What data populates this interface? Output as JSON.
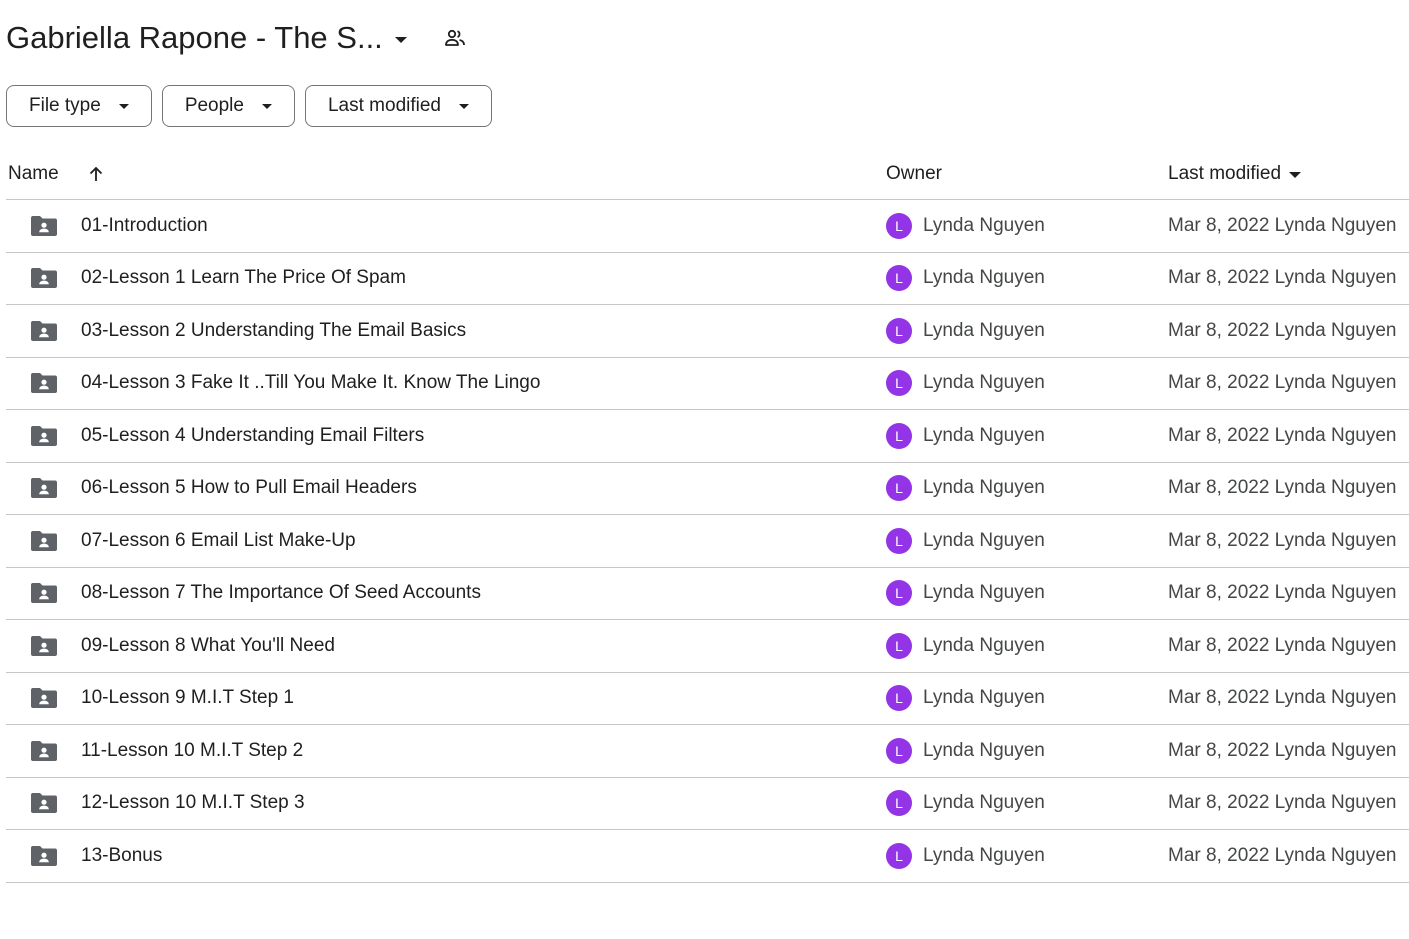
{
  "header": {
    "title": "Gabriella Rapone - The S...",
    "caret_icon": "arrow-drop-down-icon",
    "shared_icon": "people-icon"
  },
  "filters": [
    {
      "label": "File type"
    },
    {
      "label": "People"
    },
    {
      "label": "Last modified"
    }
  ],
  "columns": {
    "name": "Name",
    "owner": "Owner",
    "last_modified": "Last modified"
  },
  "colors": {
    "avatar": "#9334e6",
    "folder": "#5f6368",
    "divider": "#c7c7c7"
  },
  "rows": [
    {
      "name": "01-Introduction",
      "owner_initial": "L",
      "owner": "Lynda Nguyen",
      "modified": "Mar 8, 2022 Lynda Nguyen"
    },
    {
      "name": "02-Lesson 1  Learn The Price Of Spam",
      "owner_initial": "L",
      "owner": "Lynda Nguyen",
      "modified": "Mar 8, 2022 Lynda Nguyen"
    },
    {
      "name": "03-Lesson 2 Understanding The Email Basics",
      "owner_initial": "L",
      "owner": "Lynda Nguyen",
      "modified": "Mar 8, 2022 Lynda Nguyen"
    },
    {
      "name": "04-Lesson 3 Fake It ..Till You Make It. Know The Lingo",
      "owner_initial": "L",
      "owner": "Lynda Nguyen",
      "modified": "Mar 8, 2022 Lynda Nguyen"
    },
    {
      "name": "05-Lesson 4 Understanding Email Filters",
      "owner_initial": "L",
      "owner": "Lynda Nguyen",
      "modified": "Mar 8, 2022 Lynda Nguyen"
    },
    {
      "name": "06-Lesson 5 How to Pull Email Headers",
      "owner_initial": "L",
      "owner": "Lynda Nguyen",
      "modified": "Mar 8, 2022 Lynda Nguyen"
    },
    {
      "name": "07-Lesson 6 Email List Make-Up",
      "owner_initial": "L",
      "owner": "Lynda Nguyen",
      "modified": "Mar 8, 2022 Lynda Nguyen"
    },
    {
      "name": "08-Lesson 7 The Importance Of Seed Accounts",
      "owner_initial": "L",
      "owner": "Lynda Nguyen",
      "modified": "Mar 8, 2022 Lynda Nguyen"
    },
    {
      "name": "09-Lesson 8 What You'll Need",
      "owner_initial": "L",
      "owner": "Lynda Nguyen",
      "modified": "Mar 8, 2022 Lynda Nguyen"
    },
    {
      "name": "10-Lesson 9  M.I.T Step 1",
      "owner_initial": "L",
      "owner": "Lynda Nguyen",
      "modified": "Mar 8, 2022 Lynda Nguyen"
    },
    {
      "name": "11-Lesson 10 M.I.T Step 2",
      "owner_initial": "L",
      "owner": "Lynda Nguyen",
      "modified": "Mar 8, 2022 Lynda Nguyen"
    },
    {
      "name": "12-Lesson 10 M.I.T Step 3",
      "owner_initial": "L",
      "owner": "Lynda Nguyen",
      "modified": "Mar 8, 2022 Lynda Nguyen"
    },
    {
      "name": "13-Bonus",
      "owner_initial": "L",
      "owner": "Lynda Nguyen",
      "modified": "Mar 8, 2022 Lynda Nguyen"
    }
  ]
}
